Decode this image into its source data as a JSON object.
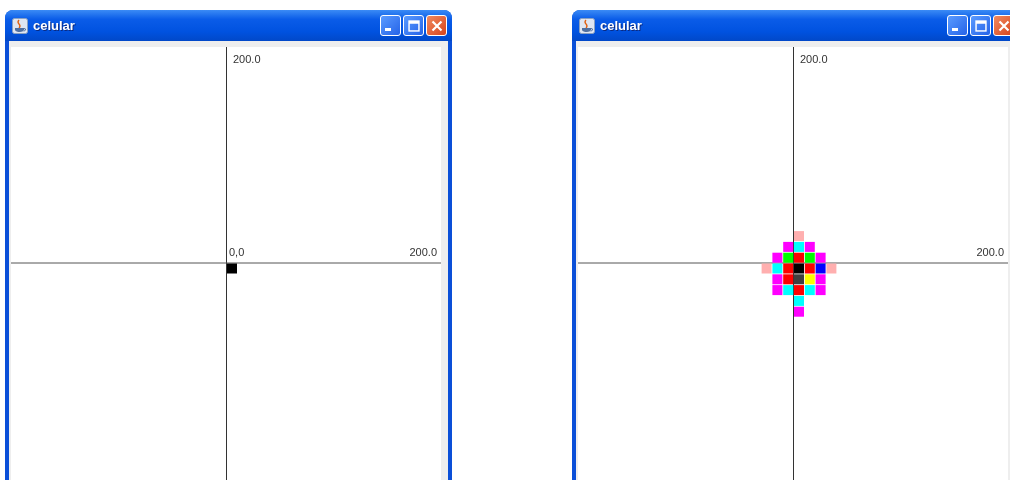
{
  "windows": [
    {
      "title": "celular",
      "y_label": "200.0",
      "x_label": "200.0",
      "origin_label": "0,0",
      "grid": [
        [
          {
            "kind": "cell",
            "color": "#000000"
          }
        ]
      ]
    },
    {
      "title": "celular",
      "y_label": "200.0",
      "x_label": "200.0",
      "grid": [
        [
          {
            "kind": "gap"
          },
          {
            "kind": "gap"
          },
          {
            "kind": "gap"
          },
          {
            "kind": "cell",
            "color": "#ffafaf"
          },
          {
            "kind": "gap"
          },
          {
            "kind": "gap"
          },
          {
            "kind": "gap"
          }
        ],
        [
          {
            "kind": "gap"
          },
          {
            "kind": "gap"
          },
          {
            "kind": "cell",
            "color": "#ff00ff"
          },
          {
            "kind": "cell",
            "color": "#00ffff"
          },
          {
            "kind": "cell",
            "color": "#ff00ff"
          },
          {
            "kind": "gap"
          },
          {
            "kind": "gap"
          }
        ],
        [
          {
            "kind": "gap"
          },
          {
            "kind": "cell",
            "color": "#ff00ff"
          },
          {
            "kind": "cell",
            "color": "#00ff00"
          },
          {
            "kind": "cell",
            "color": "#ff0000"
          },
          {
            "kind": "cell",
            "color": "#00ff00"
          },
          {
            "kind": "cell",
            "color": "#ff00ff"
          },
          {
            "kind": "gap"
          }
        ],
        [
          {
            "kind": "cell",
            "color": "#ffafaf"
          },
          {
            "kind": "cell",
            "color": "#00ffff"
          },
          {
            "kind": "cell",
            "color": "#ff0000"
          },
          {
            "kind": "cell",
            "color": "#000000"
          },
          {
            "kind": "cell",
            "color": "#ff0000"
          },
          {
            "kind": "cell",
            "color": "#0000ff"
          },
          {
            "kind": "cell",
            "color": "#ffafaf"
          }
        ],
        [
          {
            "kind": "gap"
          },
          {
            "kind": "cell",
            "color": "#ff00ff"
          },
          {
            "kind": "cell",
            "color": "#ff0000"
          },
          {
            "kind": "cell",
            "color": "#404040"
          },
          {
            "kind": "cell",
            "color": "#ffff00"
          },
          {
            "kind": "cell",
            "color": "#ff00ff"
          },
          {
            "kind": "gap"
          }
        ],
        [
          {
            "kind": "gap"
          },
          {
            "kind": "cell",
            "color": "#ff00ff"
          },
          {
            "kind": "cell",
            "color": "#00ffff"
          },
          {
            "kind": "cell",
            "color": "#ff0000"
          },
          {
            "kind": "cell",
            "color": "#00ffff"
          },
          {
            "kind": "cell",
            "color": "#ff00ff"
          },
          {
            "kind": "gap"
          }
        ],
        [
          {
            "kind": "gap"
          },
          {
            "kind": "gap"
          },
          {
            "kind": "gap"
          },
          {
            "kind": "cell",
            "color": "#00ffff"
          },
          {
            "kind": "gap"
          },
          {
            "kind": "gap"
          },
          {
            "kind": "gap"
          }
        ],
        [
          {
            "kind": "gap"
          },
          {
            "kind": "gap"
          },
          {
            "kind": "gap"
          },
          {
            "kind": "cell",
            "color": "#ff00ff"
          },
          {
            "kind": "gap"
          },
          {
            "kind": "gap"
          },
          {
            "kind": "gap"
          }
        ]
      ]
    }
  ]
}
